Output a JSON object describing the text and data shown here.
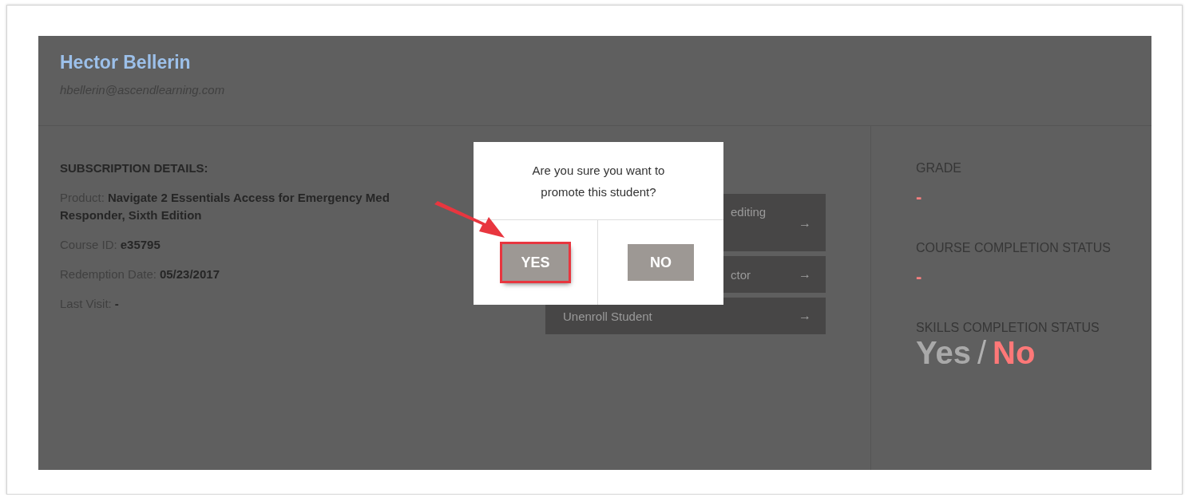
{
  "student": {
    "name": "Hector Bellerin",
    "email": "hbellerin@ascendlearning.com"
  },
  "subscription": {
    "heading": "SUBSCRIPTION DETAILS:",
    "fields": [
      {
        "label": "Product:",
        "value_lines": [
          "Navigate 2 Essentials Access for Emergency Med",
          "Responder, Sixth Edition"
        ]
      },
      {
        "label": "Course ID:",
        "value_lines": [
          "e35795"
        ]
      },
      {
        "label": "Redemption Date:",
        "value_lines": [
          "05/23/2017"
        ]
      },
      {
        "label": "Last Visit:",
        "value_lines": [
          "-"
        ]
      }
    ]
  },
  "actions": [
    {
      "label": "editing",
      "arrow": "→",
      "tall": true
    },
    {
      "label": "ctor",
      "arrow": "→",
      "tall": false
    },
    {
      "label": "Unenroll Student",
      "arrow": "→",
      "tall": false
    }
  ],
  "status": [
    {
      "kind": "value",
      "label": "GRADE",
      "value": "-"
    },
    {
      "kind": "value",
      "label": "COURSE COMPLETION STATUS",
      "value": "-"
    },
    {
      "kind": "choice",
      "label": "SKILLS COMPLETION STATUS",
      "separator": "/",
      "options": [
        {
          "label": "Yes",
          "selected": false
        },
        {
          "label": "No",
          "selected": true
        }
      ]
    }
  ],
  "dialog": {
    "message": "Are you sure you want to promote this student?",
    "buttons": [
      {
        "label": "YES",
        "highlighted": true
      },
      {
        "label": "NO",
        "highlighted": false
      }
    ]
  }
}
